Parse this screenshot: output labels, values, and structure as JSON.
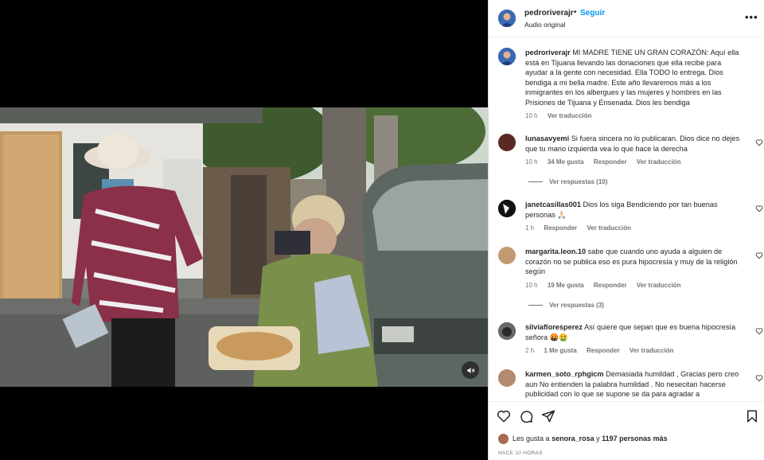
{
  "header": {
    "username": "pedroriverajr",
    "dot": "•",
    "follow_label": "Seguir",
    "audio": "Audio original",
    "more_icon": "more-horizontal-icon"
  },
  "caption": {
    "username": "pedroriverajr",
    "text": "MI MADRE TIENE UN GRAN CORAZÓN: Aquí ella está en Tijuana llevando las donaciones que ella recibe para ayudar a la gente con necesidad. Ella TODO lo entrega. Dios bendiga a mi bella madre. Este año llevaremos más a los inmigrantes en los albergues y las mujeres y hombres en las Prisiones de Tijuana y Ensenada. Dios les bendiga",
    "time": "10 h",
    "translate": "Ver traducción"
  },
  "comments": [
    {
      "username": "lunasavyemi",
      "text": "Si fuera sincera no lo publicaran. Dios dice no dejes que tu mano izquierda vea lo que hace la derecha",
      "time": "10 h",
      "likes": "34 Me gusta",
      "reply": "Responder",
      "translate": "Ver traducción",
      "replies_label": "Ver respuestas (10)"
    },
    {
      "username": "janetcasillas001",
      "text": "Dios los siga Bendiciendo por tan buenas personas 🙏🏻",
      "time": "1 h",
      "likes": "",
      "reply": "Responder",
      "translate": "Ver traducción",
      "replies_label": ""
    },
    {
      "username": "margarita.leon.10",
      "text": "sabe que cuando uno ayuda a alguien de corazón no se publica eso es pura hipocresía y muy de la religión según",
      "time": "10 h",
      "likes": "19 Me gusta",
      "reply": "Responder",
      "translate": "Ver traducción",
      "replies_label": "Ver respuestas (3)"
    },
    {
      "username": "silviafloresperez",
      "text": "Así quiere que sepan que es buena hipocresía señora 🤬🤮",
      "time": "2 h",
      "likes": "1 Me gusta",
      "reply": "Responder",
      "translate": "Ver traducción",
      "replies_label": ""
    },
    {
      "username": "karmen_soto_rphgicm",
      "text": "Demasiada humildad , Gracias pero creo aun No entienden la palabra humildad . No nesecitan hacerse publicidad con lo que se supone se da para agradar a",
      "time": "",
      "likes": "",
      "reply": "",
      "translate": "",
      "replies_label": ""
    }
  ],
  "footer": {
    "likes_prefix": "Les gusta a",
    "likes_user": "senora_rosa",
    "likes_middle": "y",
    "likes_count": "1197 personas más",
    "time": "HACE 10 HORAS"
  },
  "colors": {
    "link_blue": "#0095f6",
    "text": "#262626",
    "muted": "#737373"
  }
}
